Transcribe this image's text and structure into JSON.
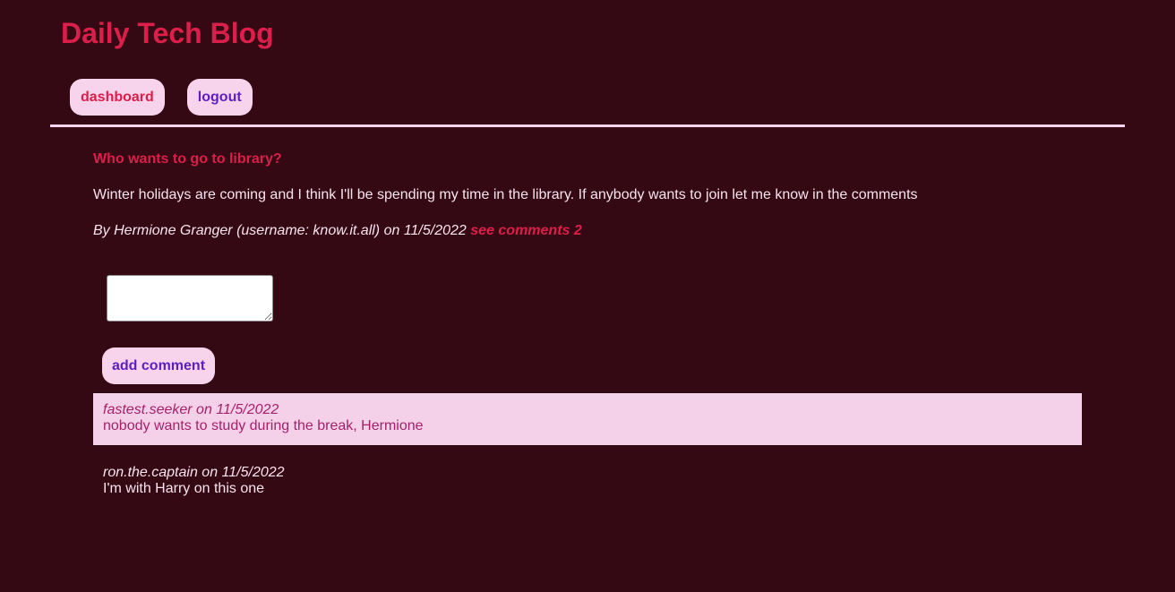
{
  "header": {
    "title": "Daily Tech Blog"
  },
  "nav": {
    "dashboard_label": "dashboard",
    "logout_label": "logout"
  },
  "post": {
    "title": "Who wants to go to library?",
    "body": "Winter holidays are coming and I think I'll be spending my time in the library. If anybody wants to join let me know in the comments",
    "meta": "By Hermione Granger (username: know.it.all) on 11/5/2022",
    "comments_link": "see comments 2"
  },
  "comment_form": {
    "input_value": "",
    "submit_label": "add comment"
  },
  "comments": [
    {
      "author": "fastest.seeker on 11/5/2022",
      "text": "nobody wants to study during the break, Hermione"
    },
    {
      "author": "ron.the.captain on 11/5/2022",
      "text": "I'm with Harry on this one"
    }
  ],
  "colors": {
    "background": "#340914",
    "accent": "#dc1e4a",
    "button_bg": "#f8d4ec",
    "button_text": "#5b1fc0",
    "highlight_bg": "#f5d0e9",
    "highlight_text": "#a3226a"
  }
}
